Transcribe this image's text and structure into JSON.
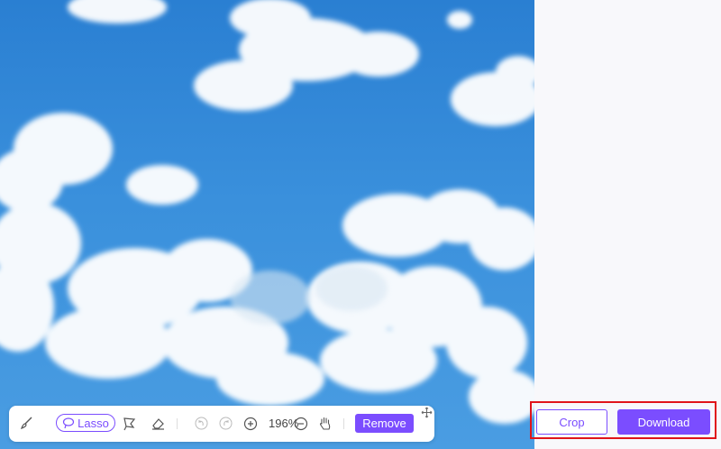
{
  "toolbar": {
    "lasso_label": "Lasso",
    "zoom_value": "196%",
    "remove_label": "Remove"
  },
  "actions": {
    "crop_label": "Crop",
    "download_label": "Download"
  },
  "colors": {
    "accent": "#7b4dff",
    "highlight": "#e0141a",
    "sky": "#3a90dc"
  },
  "icons": {
    "brush": "brush-icon",
    "lasso": "lasso-icon",
    "polygon_lasso": "polygon-lasso-icon",
    "eraser": "eraser-icon",
    "undo": "undo-icon",
    "redo": "redo-icon",
    "zoom_in": "zoom-in-icon",
    "zoom_out": "zoom-out-icon",
    "hand": "hand-pan-icon",
    "move": "move-icon"
  }
}
